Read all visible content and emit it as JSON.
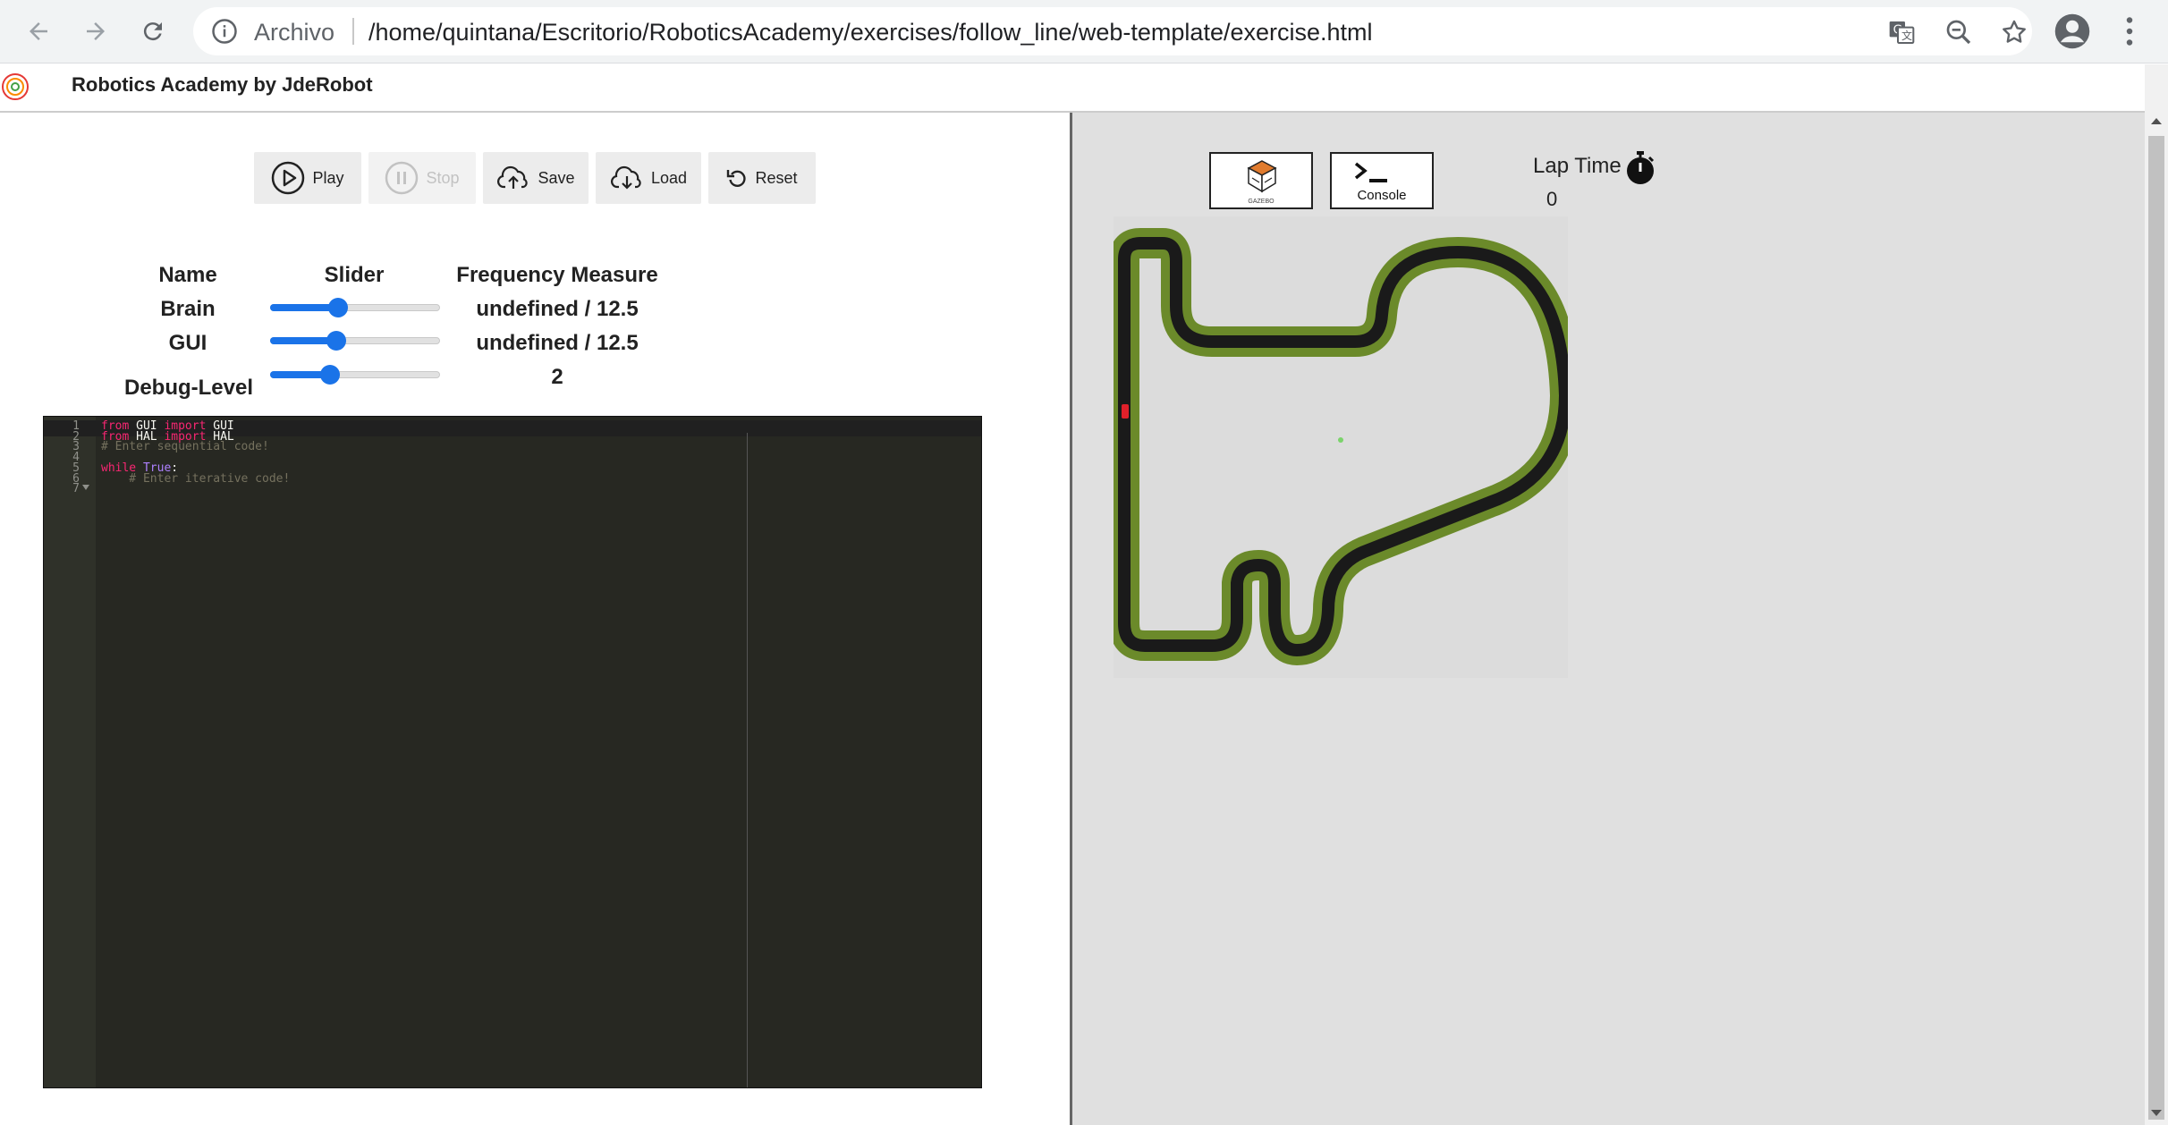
{
  "browser": {
    "scheme_label": "Archivo",
    "url": "/home/quintana/Escritorio/RoboticsAcademy/exercises/follow_line/web-template/exercise.html"
  },
  "app": {
    "title": "Robotics Academy by JdeRobot"
  },
  "toolbar": {
    "play": "Play",
    "stop": "Stop",
    "save": "Save",
    "load": "Load",
    "reset": "Reset"
  },
  "frequency": {
    "headers": {
      "name": "Name",
      "slider": "Slider",
      "measure": "Frequency Measure"
    },
    "rows": [
      {
        "name": "Brain",
        "measure": "undefined / 12.5",
        "slider_fraction": 0.4
      },
      {
        "name": "GUI",
        "measure": "undefined / 12.5",
        "slider_fraction": 0.39
      },
      {
        "name": "Debug-Level",
        "measure": "2",
        "slider_fraction": 0.35
      }
    ]
  },
  "editor": {
    "line_numbers": [
      "1",
      "2",
      "3",
      "4",
      "5",
      "6",
      "7"
    ],
    "lines": [
      [
        {
          "t": "from",
          "c": "kw"
        },
        {
          "t": " GUI ",
          "c": ""
        },
        {
          "t": "import",
          "c": "kw"
        },
        {
          "t": " GUI",
          "c": ""
        }
      ],
      [
        {
          "t": "from",
          "c": "kw"
        },
        {
          "t": " HAL ",
          "c": ""
        },
        {
          "t": "import",
          "c": "kw"
        },
        {
          "t": " HAL",
          "c": ""
        }
      ],
      [
        {
          "t": "# Enter sequential code!",
          "c": "cm"
        }
      ],
      [],
      [
        {
          "t": "while",
          "c": "kw"
        },
        {
          "t": " ",
          "c": ""
        },
        {
          "t": "True",
          "c": "bi"
        },
        {
          "t": ":",
          "c": ""
        }
      ],
      [
        {
          "t": "    # Enter iterative code!",
          "c": "cm"
        }
      ],
      []
    ]
  },
  "simulation": {
    "gazebo_label": "GAZEBO",
    "console_label": "Console",
    "lap_time_label": "Lap Time",
    "lap_time_value": "0"
  },
  "colors": {
    "accent": "#1a73e8",
    "editor_bg": "#272822",
    "track_green": "#6b8a2a",
    "track_black": "#1a1a1a",
    "car": "#e0202a"
  },
  "icons": [
    "back-arrow-icon",
    "forward-arrow-icon",
    "reload-icon",
    "info-icon",
    "translate-icon",
    "zoom-out-icon",
    "star-icon",
    "account-icon",
    "menu-dots-icon",
    "play-icon",
    "pause-icon",
    "cloud-upload-icon",
    "cloud-download-icon",
    "reset-icon",
    "gazebo-icon",
    "terminal-icon",
    "stopwatch-icon"
  ]
}
